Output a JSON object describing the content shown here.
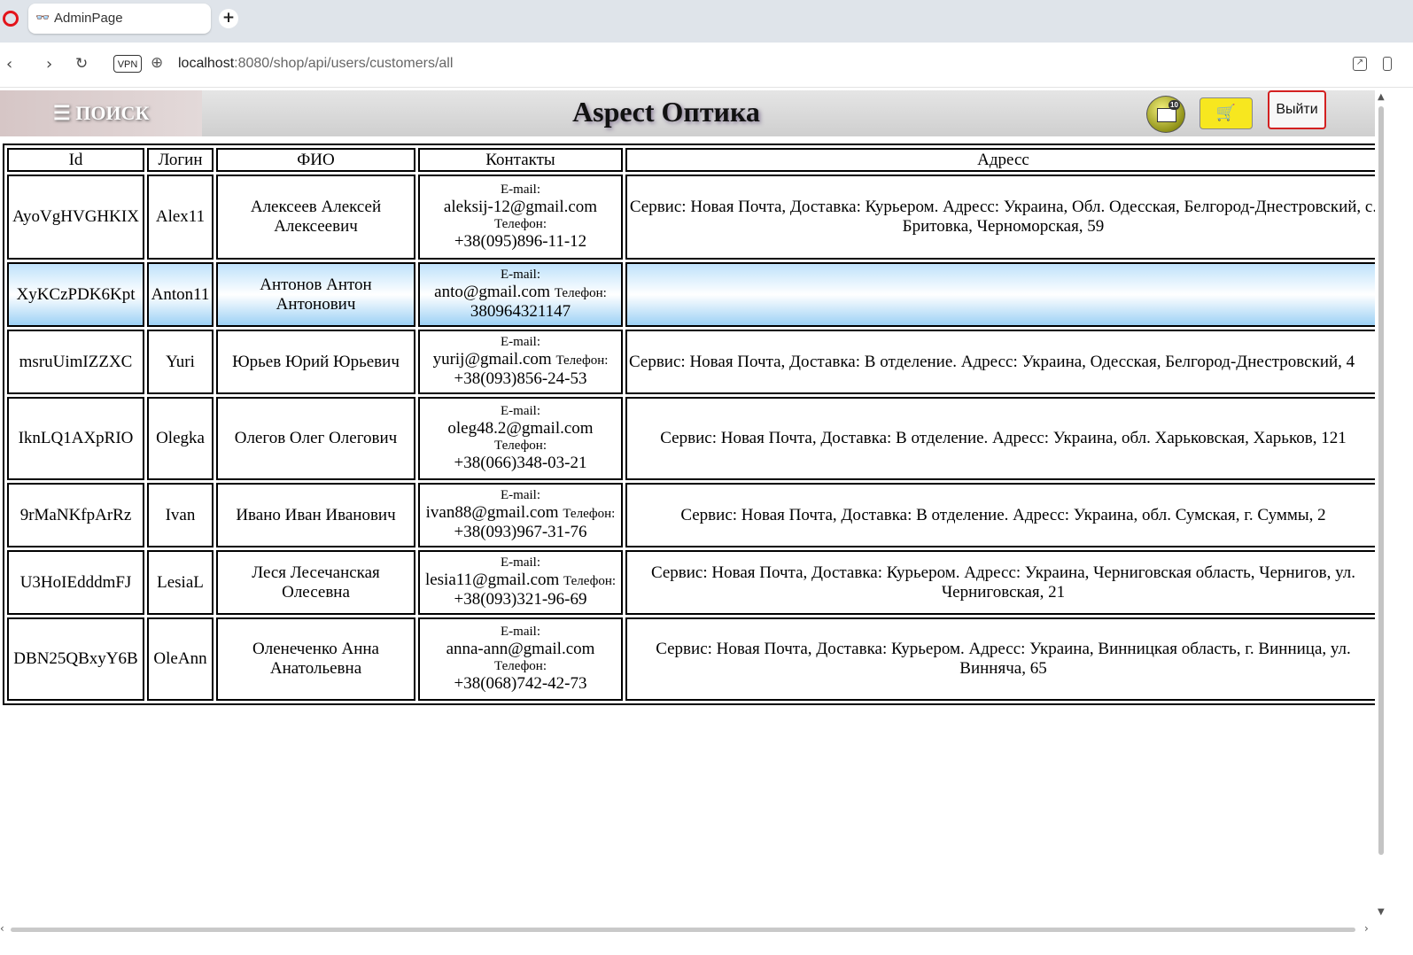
{
  "browser": {
    "tab_title": "AdminPage",
    "tab_icon": "glasses-icon",
    "new_tab_label": "+",
    "vpn_label": "VPN",
    "url_host": "localhost",
    "url_rest": ":8080/shop/api/users/customers/all"
  },
  "header": {
    "menu_label": "☰ ПОИСК",
    "title": "Aspect Оптика",
    "mail_badge": "10",
    "logout_label": "Выйти"
  },
  "table": {
    "columns": [
      "Id",
      "Логин",
      "ФИО",
      "Контакты",
      "Адресс"
    ],
    "email_label": "E-mail:",
    "phone_label": "Телефон:",
    "rows": [
      {
        "id": "AyoVgHVGHKIX",
        "login": "Alex11",
        "name": "Алексеев Алексей Алексеевич",
        "email": "aleksij-12@gmail.com",
        "phone": "+38(095)896-11-12",
        "address": "Сервис: Новая Почта, Доставка: Курьером. Адресс: Украина, Обл. Одесская, Белгород-Днестровский, с. Бритовка, Черноморская, 59"
      },
      {
        "id": "XyKCzPDK6Kpt",
        "login": "Anton11",
        "name": "Антонов Антон Антонович",
        "email": "anto@gmail.com",
        "phone": "380964321147",
        "address": ""
      },
      {
        "id": "msruUimIZZXC",
        "login": "Yuri",
        "name": "Юрьев Юрий Юрьевич",
        "email": "yurij@gmail.com",
        "phone": "+38(093)856-24-53",
        "address": "Сервис: Новая Почта, Доставка: В отделение. Адресс: Украина, Одесская, Белгород-Днестровский, 4"
      },
      {
        "id": "IknLQ1AXpRIO",
        "login": "Olegka",
        "name": "Олегов Олег Олегович",
        "email": "oleg48.2@gmail.com",
        "phone": "+38(066)348-03-21",
        "address": "Сервис: Новая Почта, Доставка: В отделение. Адресс: Украина, обл. Харьковская, Харьков, 121"
      },
      {
        "id": "9rMaNKfpArRz",
        "login": "Ivan",
        "name": "Ивано Иван Иванович",
        "email": "ivan88@gmail.com",
        "phone": "+38(093)967-31-76",
        "address": "Сервис: Новая Почта, Доставка: В отделение. Адресс: Украина, обл. Сумская, г. Суммы, 2"
      },
      {
        "id": "U3HoIEdddmFJ",
        "login": "LesiaL",
        "name": "Леся Лесечанская Олесевна",
        "email": "lesia11@gmail.com",
        "phone": "+38(093)321-96-69",
        "address": "Сервис: Новая Почта, Доставка: Курьером. Адресс: Украина, Черниговская область, Чернигов, ул. Черниговская, 21"
      },
      {
        "id": "DBN25QBxyY6B",
        "login": "OleAnn",
        "name": "Оленеченко Анна Анатольевна",
        "email": "anna-ann@gmail.com",
        "phone": "+38(068)742-42-73",
        "address": "Сервис: Новая Почта, Доставка: Курьером. Адресс: Украина, Винницкая область, г. Винница, ул. Винняча, 65"
      }
    ]
  }
}
